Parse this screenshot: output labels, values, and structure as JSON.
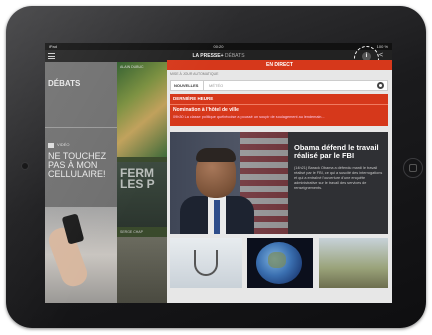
{
  "status_bar": {
    "carrier": "iPad",
    "time": "00:20",
    "battery": "100 %"
  },
  "header": {
    "brand": "LA PRESSE+",
    "section": "DÉBATS"
  },
  "left_column": {
    "section_title": "DÉBATS",
    "video_label": "VIDÉO",
    "headline": "NE TOUCHEZ PAS À MON CELLULAIRE!"
  },
  "middle_column": {
    "byline_top": "ALAIN DUBUC",
    "headline": "FERM LES P",
    "byline_bottom": "SERGE CHAP"
  },
  "live_panel": {
    "live_label": "EN DIRECT",
    "subtitle": "MISE À JOUR AUTOMATIQUE",
    "tab_active": "NOUVELLES",
    "tab_inactive": "MÉTÉO",
    "breaking_label": "DERNIÈRE HEURE",
    "breaking_title": "Nomination à l'hôtel de ville",
    "breaking_text": "09h30 La classe politique québécoise a poussé un soupir de soulagement au lendemain...",
    "feature_title": "Obama défend le travail réalisé par le FBI",
    "feature_body": "(14h21) Barack Obama a défendu mardi le travail réalisé par le FBI, ce qui a suscité des interrogations et qui a entraîné l'ouverture d'une enquête administrative sur le travail des services de renseignements."
  }
}
